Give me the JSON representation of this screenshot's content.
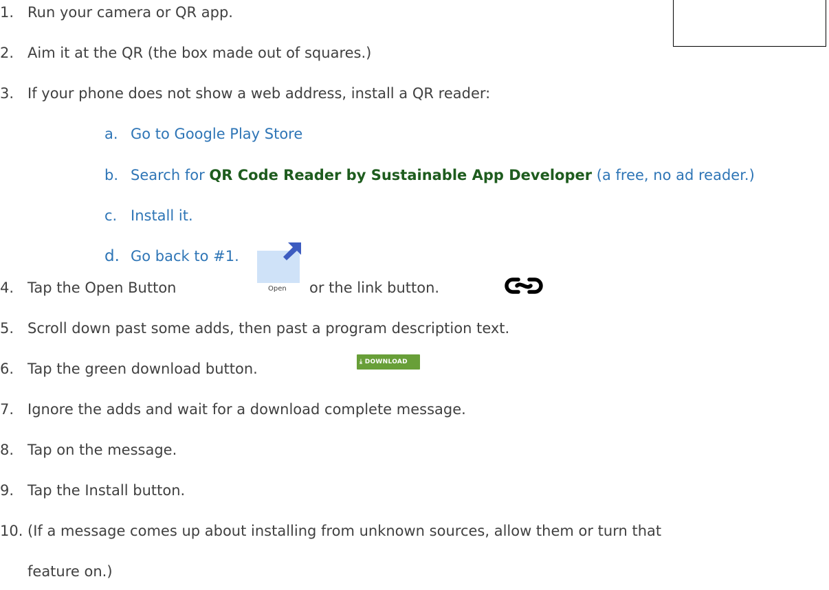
{
  "steps": [
    {
      "num": "1.",
      "text": "Run your camera or QR app."
    },
    {
      "num": "2.",
      "text": "Aim it at the QR (the box made out of squares.)"
    },
    {
      "num": "3.",
      "text": "If your phone does not show a web address, install a QR reader:"
    },
    {
      "num": "4.",
      "text_before": "Tap the Open Button",
      "text_after": "or the link button."
    },
    {
      "num": "5.",
      "text": "Scroll down past some adds, then past a program description text."
    },
    {
      "num": "6.",
      "text": "Tap the green download button."
    },
    {
      "num": "7.",
      "text": "Ignore the adds and wait for a download complete message."
    },
    {
      "num": "8.",
      "text": "Tap on the message."
    },
    {
      "num": "9.",
      "text": "Tap the Install button."
    },
    {
      "num": "10.",
      "text_line1": "(If a message comes up about installing from unknown sources, allow them or turn that",
      "text_line2": "feature on.)"
    }
  ],
  "substeps": [
    {
      "letter": "a.",
      "text": "Go to Google Play Store"
    },
    {
      "letter": "b.",
      "text_before": "Search for",
      "text_bold": "QR Code Reader by Sustainable App Developer",
      "text_after": "(a free, no ad reader.)"
    },
    {
      "letter": "c.",
      "text": "Install it."
    },
    {
      "letter": "d.",
      "text": "Go back to #1."
    }
  ],
  "open_button": {
    "label": "Open",
    "icon": "open-external-arrow-icon"
  },
  "link_button": {
    "icon": "link-icon"
  },
  "download_button": {
    "label": "⤓ DOWNLOAD",
    "color": "#689f38"
  },
  "colors": {
    "body_text": "#404040",
    "substep_text": "#2e75b6",
    "bold_green": "#1e5c1e"
  }
}
